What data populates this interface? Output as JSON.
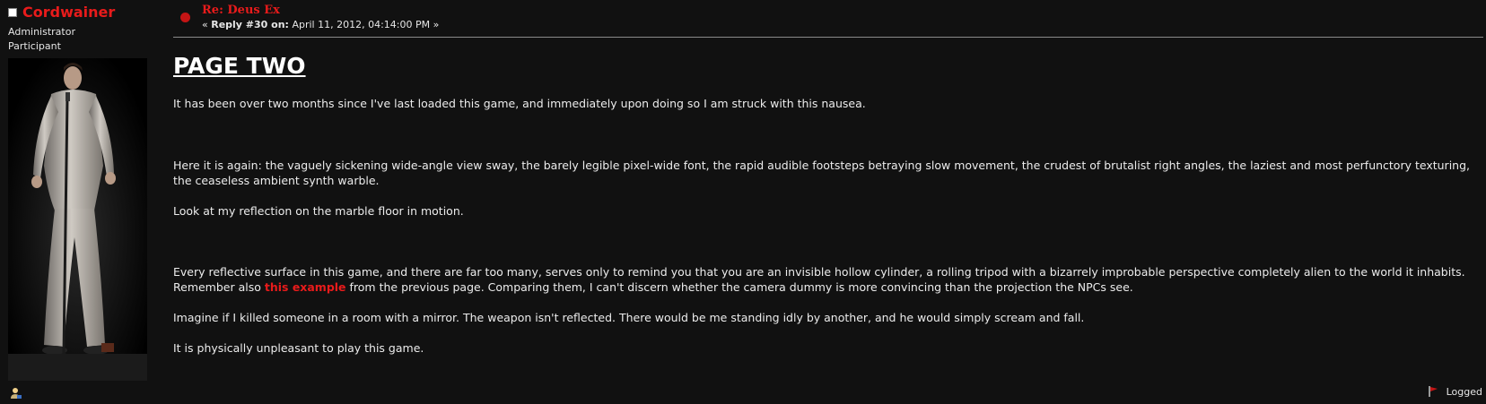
{
  "poster": {
    "name": "Cordwainer",
    "role": "Administrator",
    "group": "Participant"
  },
  "post": {
    "subject": "Re: Deus Ex",
    "meta_open": "« ",
    "reply_label": "Reply #30 on:",
    "date": "April 11, 2012, 04:14:00 PM",
    "meta_close": " »"
  },
  "body": {
    "title": "PAGE TWO",
    "p1": "It has been over two months since I've last loaded this game, and immediately upon doing so I am struck with this nausea.",
    "p2": "Here it is again: the vaguely sickening wide-angle view sway, the barely legible pixel-wide font, the rapid audible footsteps betraying slow movement, the crudest of brutalist right angles, the laziest and most perfunctory texturing, the ceaseless ambient synth warble.",
    "p3": "Look at my reflection on the marble floor in motion.",
    "p4_before": "Every reflective surface in this game, and there are far too many, serves only to remind you that you are an invisible hollow cylinder, a rolling tripod with a bizarrely improbable perspective completely alien to the world it inhabits. Remember also ",
    "p4_link": "this example",
    "p4_after": " from the previous page. Comparing them, I can't discern whether the camera dummy is more convincing than the projection the NPCs see.",
    "p5": "Imagine if I killed someone in a room with a mirror. The weapon isn't reflected. There would be me standing idly by another, and he would simply scream and fall.",
    "p6": "It is physically unpleasant to play this game."
  },
  "footer": {
    "logged": "Logged"
  },
  "colors": {
    "background": "#111111",
    "accent_red": "#e81b1b",
    "text": "#e6e6e6"
  },
  "icons": {
    "online": "online-status-icon",
    "profile": "profile-icon",
    "post": "post-message-icon",
    "logged": "logged-ip-icon"
  }
}
